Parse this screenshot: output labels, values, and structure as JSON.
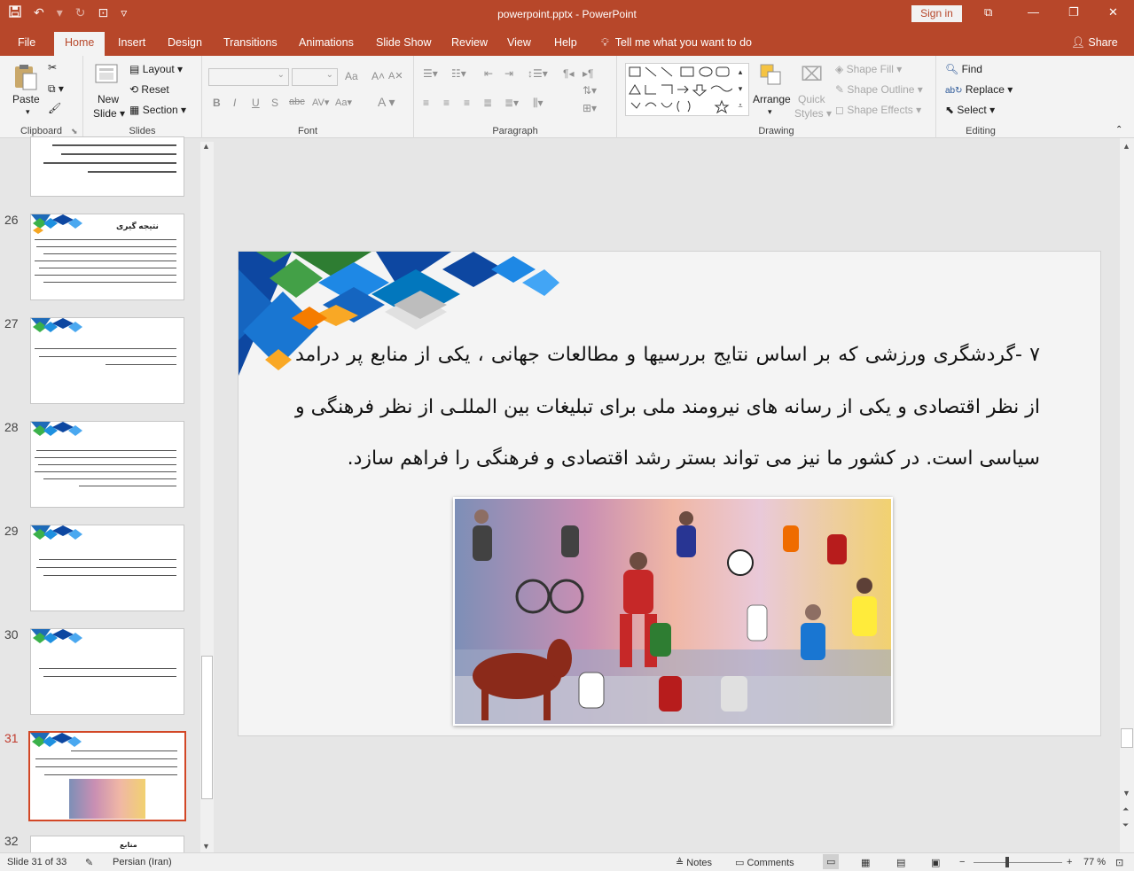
{
  "window": {
    "title": "powerpoint.pptx - PowerPoint",
    "signin": "Sign in"
  },
  "tabs": [
    "File",
    "Home",
    "Insert",
    "Design",
    "Transitions",
    "Animations",
    "Slide Show",
    "Review",
    "View",
    "Help"
  ],
  "active_tab": "Home",
  "tellme": "Tell me what you want to do",
  "share": "Share",
  "ribbon": {
    "clipboard": {
      "paste": "Paste",
      "label": "Clipboard"
    },
    "slides": {
      "new_slide_1": "New",
      "new_slide_2": "Slide",
      "layout": "Layout",
      "reset": "Reset",
      "section": "Section",
      "label": "Slides"
    },
    "font": {
      "label": "Font",
      "bold": "B",
      "italic": "I",
      "underline": "U",
      "shadow": "S",
      "strike": "abc",
      "spacing": "AV",
      "case": "Aa",
      "grow": "A",
      "shrink": "A",
      "color": "A"
    },
    "paragraph": {
      "label": "Paragraph"
    },
    "drawing": {
      "arrange": "Arrange",
      "quick_styles_1": "Quick",
      "quick_styles_2": "Styles",
      "shape_fill": "Shape Fill",
      "shape_outline": "Shape Outline",
      "shape_effects": "Shape Effects",
      "label": "Drawing"
    },
    "editing": {
      "find": "Find",
      "replace": "Replace",
      "select": "Select",
      "label": "Editing"
    }
  },
  "thumbnails": [
    {
      "num": "26",
      "title": "نتیجه گیری"
    },
    {
      "num": "27"
    },
    {
      "num": "28"
    },
    {
      "num": "29"
    },
    {
      "num": "30"
    },
    {
      "num": "31",
      "selected": true
    },
    {
      "num": "32",
      "title": "منابع"
    }
  ],
  "slide": {
    "text": "۷ -گردشگری ورزشی که بر اساس نتایج بررسیها و مطالعات جهانی ، یکی از منابع پر درامد از نظر اقتصادی و یکی از رسانه های نیرومند ملی برای تبلیغات بین المللـی از نظر فرهنگی و سیاسی است. در کشور ما نیز می تواند بستر رشد اقتصادی و فرهنگی را فراهم سازد."
  },
  "status": {
    "slide_of": "Slide 31 of 33",
    "language": "Persian (Iran)",
    "notes": "Notes",
    "comments": "Comments",
    "zoom": "77 %"
  },
  "colors": {
    "accent": "#b7472a",
    "selected_border": "#d24726"
  }
}
